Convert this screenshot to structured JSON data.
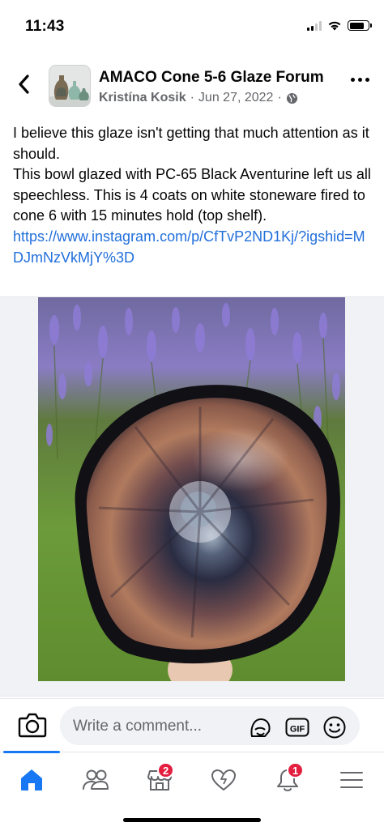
{
  "status_bar": {
    "time": "11:43",
    "icons": [
      "cellular-signal-icon",
      "wifi-icon",
      "battery-icon"
    ]
  },
  "header": {
    "back_icon": "chevron-left-icon",
    "group_name": "AMACO Cone 5-6 Glaze Forum",
    "author": "Kristína Kosik",
    "separator": "·",
    "date": "Jun 27, 2022",
    "audience_icon": "globe-icon",
    "more_icon": "more-dots-icon"
  },
  "post": {
    "paragraphs": [
      "I believe this glaze isn't getting that much attention as it should.",
      "This bowl glazed with PC-65 Black Aventurine left us all speechless. This is 4 coats on white stoneware fired to cone 6 with 15 minutes hold (top shelf)."
    ],
    "link": "https://www.instagram.com/p/CfTvP2ND1Kj/?igshid=MDJmNzVkMjY%3D"
  },
  "comment_bar": {
    "camera_icon": "camera-icon",
    "placeholder": "Write a comment...",
    "icons": [
      "avatar-sticker-icon",
      "gif-icon",
      "emoji-icon"
    ],
    "gif_label": "GIF"
  },
  "tab_bar": {
    "tabs": [
      {
        "name": "home",
        "icon": "home-icon",
        "active": true
      },
      {
        "name": "groups",
        "icon": "people-icon",
        "active": false
      },
      {
        "name": "marketplace",
        "icon": "marketplace-icon",
        "badge": "2",
        "active": false
      },
      {
        "name": "dating",
        "icon": "heart-icon",
        "active": false
      },
      {
        "name": "notifications",
        "icon": "bell-icon",
        "badge": "1",
        "active": false
      },
      {
        "name": "menu",
        "icon": "menu-icon",
        "active": false
      }
    ]
  },
  "colors": {
    "link": "#216fdb",
    "active_tab": "#1877f2",
    "badge": "#e41e3f",
    "secondary_text": "#65676b"
  }
}
